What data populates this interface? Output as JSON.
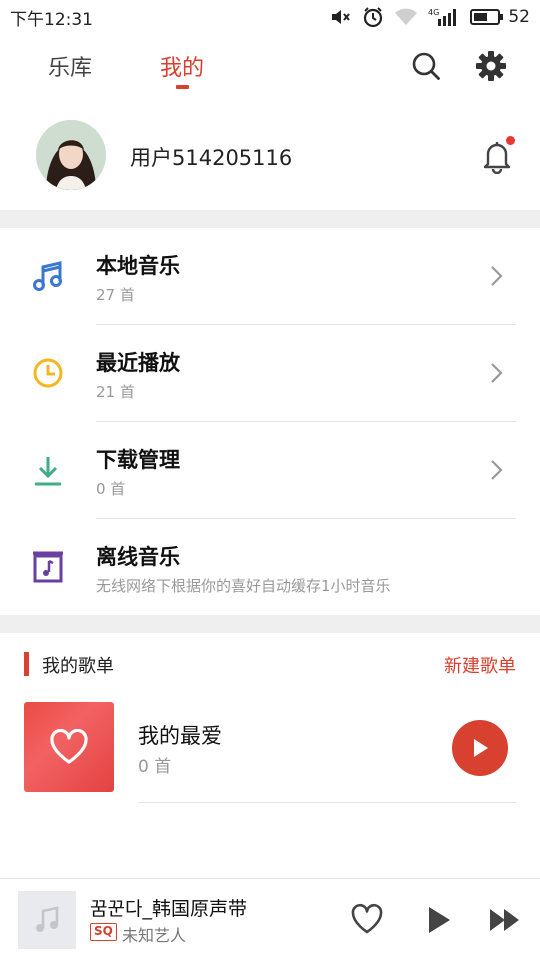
{
  "status_bar": {
    "time": "下午12:31",
    "network": "4G",
    "battery": "52"
  },
  "topnav": {
    "tabs": [
      "乐库",
      "我的"
    ],
    "active_tab": "我的",
    "accent": "#d8402f"
  },
  "profile": {
    "username": "用户514205116",
    "has_notification": true
  },
  "menu": [
    {
      "title": "本地音乐",
      "subtitle": "27 首",
      "icon": "music-note-icon",
      "color": "#3a78d0"
    },
    {
      "title": "最近播放",
      "subtitle": "21 首",
      "icon": "clock-icon",
      "color": "#f2b824"
    },
    {
      "title": "下载管理",
      "subtitle": "0 首",
      "icon": "download-icon",
      "color": "#3fae86"
    },
    {
      "title": "离线音乐",
      "subtitle": "无线网络下根据你的喜好自动缓存1小时音乐",
      "icon": "offline-music-icon",
      "color": "#6a3fa2"
    }
  ],
  "playlists": {
    "section_title": "我的歌单",
    "new_label": "新建歌单",
    "items": [
      {
        "title": "我的最爱",
        "count": "0 首"
      }
    ]
  },
  "mini_player": {
    "title": "꿈꾼다_韩国原声带",
    "quality_badge": "SQ",
    "artist": "未知艺人"
  }
}
